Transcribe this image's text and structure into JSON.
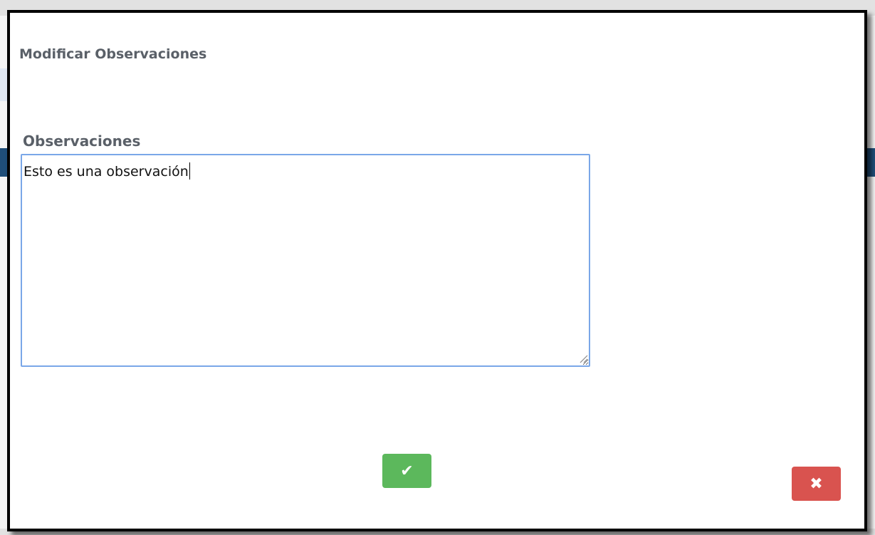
{
  "dialog": {
    "title": "Modificar Observaciones",
    "field_label": "Observaciones",
    "observaciones_value": "Esto es una observación",
    "confirm_icon": "check-icon",
    "cancel_icon": "close-icon",
    "confirm_color": "#5cb85c",
    "cancel_color": "#d9534f",
    "confirm_glyph": "✔",
    "cancel_glyph": "✖"
  }
}
